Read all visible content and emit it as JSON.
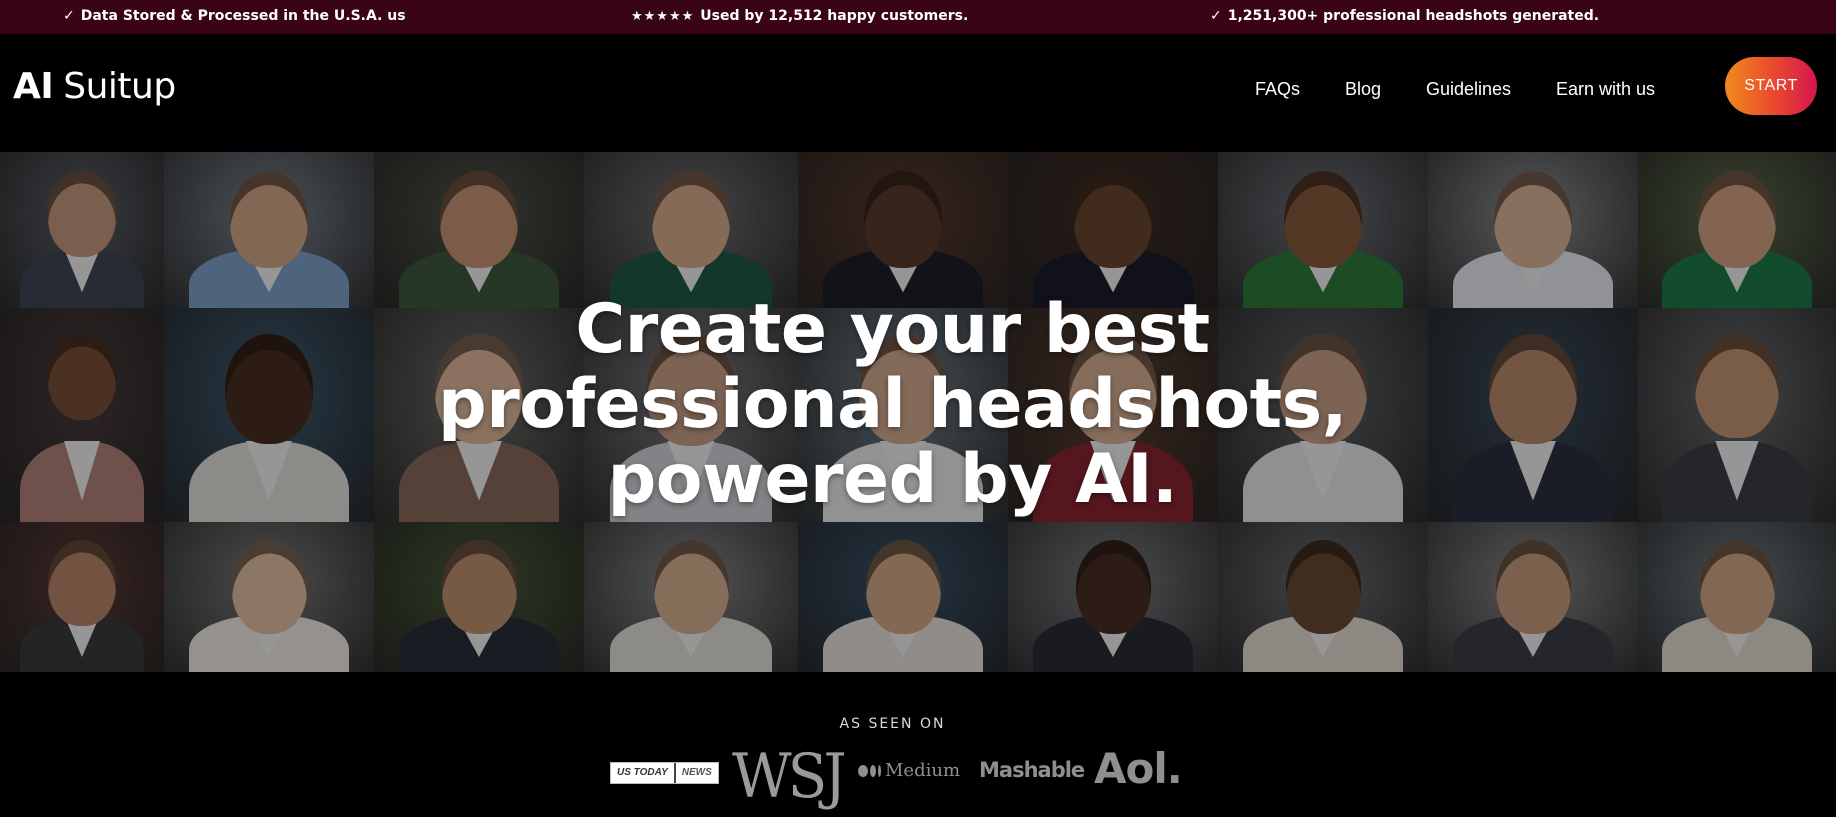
{
  "topbar": {
    "item1": "Data Stored & Processed in the U.S.A. us",
    "item2_stars": "★★★★★",
    "item2": "Used by 12,512 happy customers.",
    "item3": "1,251,300+ professional headshots generated.",
    "check": "✓"
  },
  "header": {
    "logo_ai": "AI",
    "logo_suitup": "Suitup",
    "nav": [
      "FAQs",
      "Blog",
      "Guidelines",
      "Earn with us"
    ],
    "start_label": "START"
  },
  "hero": {
    "headline_line1": "Create your best",
    "headline_line2": "professional headshots,",
    "headline_line3": "powered by AI."
  },
  "seen_on": {
    "label": "AS SEEN ON",
    "logos": {
      "usatoday_a": "US TODAY",
      "usatoday_b": "NEWS",
      "wsj": "WSJ",
      "medium": "Medium",
      "mashable": "Mashable",
      "aol": "Aol."
    }
  },
  "colors": {
    "topbar_bg": "#3a0418",
    "start_gradient": [
      "#f08a1d",
      "#e9472f",
      "#d4154f"
    ],
    "logo_gray": "#8f8f8f"
  }
}
